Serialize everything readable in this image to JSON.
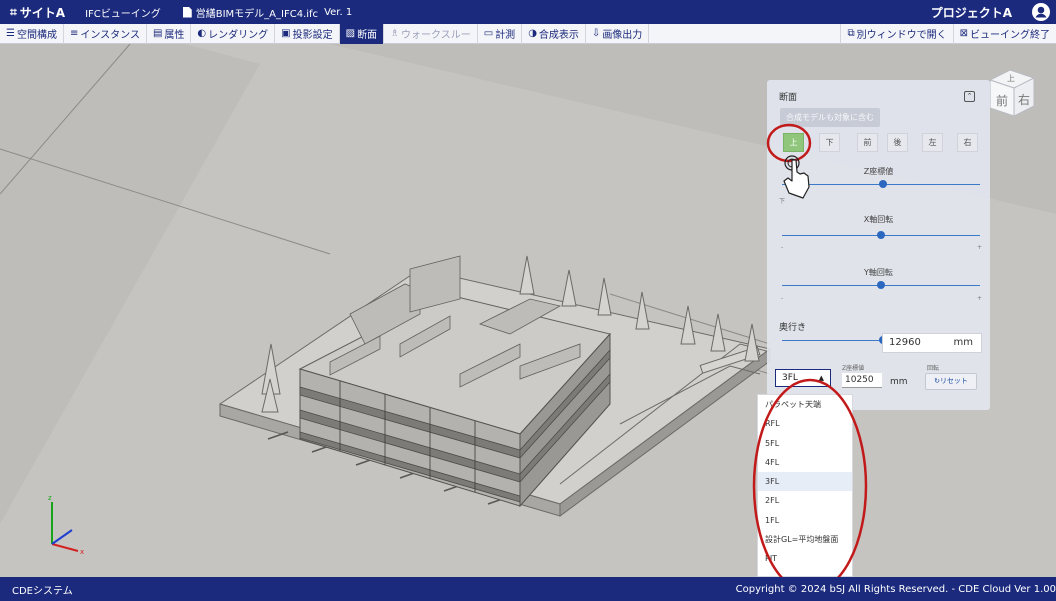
{
  "header": {
    "site_label": "サイトA",
    "app_label": "IFCビューイング",
    "file_name": "営繕BIMモデル_A_IFC4.ifc",
    "version": "Ver. 1",
    "project": "プロジェクトA"
  },
  "toolbar": {
    "items": [
      {
        "icon": "☰",
        "label": "空間構成"
      },
      {
        "icon": "≡",
        "label": "インスタンス"
      },
      {
        "icon": "▤",
        "label": "属性"
      },
      {
        "icon": "◐",
        "label": "レンダリング"
      },
      {
        "icon": "▣",
        "label": "投影設定"
      },
      {
        "icon": "▨",
        "label": "断面"
      },
      {
        "icon": "♗",
        "label": "ウォークスルー"
      },
      {
        "icon": "▭",
        "label": "計測"
      },
      {
        "icon": "◑",
        "label": "合成表示"
      },
      {
        "icon": "⇩",
        "label": "画像出力"
      }
    ],
    "active_index": 5,
    "disabled_index": 6,
    "open_window": "別ウィンドウで開く",
    "end_viewing": "ビューイング終了"
  },
  "section_panel": {
    "title": "断面",
    "include_models": "合成モデルも対象に含む",
    "directions": [
      "上",
      "下",
      "前",
      "後",
      "左",
      "右"
    ],
    "selected_direction": "上",
    "z_slider": {
      "label": "Z座標値",
      "min_label": "下",
      "value_fraction": 0.51
    },
    "x_slider": {
      "label": "X軸回転",
      "value_fraction": 0.5
    },
    "y_slider": {
      "label": "Y軸回転",
      "value_fraction": 0.5
    },
    "depth": {
      "label": "奥行き",
      "value": "12960",
      "unit": "mm",
      "value_fraction": 0.51
    },
    "floor_selected": "3FL",
    "z_caption": "Z座標値",
    "z_value": "10250",
    "z_unit": "mm",
    "rotation_caption": "回転",
    "reset_label": "リセット"
  },
  "floor_options": [
    "パラペット天端",
    "RFL",
    "5FL",
    "4FL",
    "3FL",
    "2FL",
    "1FL",
    "設計GL=平均地盤面",
    "PIT"
  ],
  "viewcube": {
    "top": "上",
    "front": "前",
    "right": "右"
  },
  "axes": {
    "x": "x",
    "y": "y",
    "z": "z"
  },
  "footer": {
    "system": "CDEシステム",
    "copyright": "Copyright © 2024 bSJ All Rights Reserved. - CDE Cloud Ver 1.00"
  },
  "colors": {
    "navy": "#1b2a7d",
    "selected_green": "#8fc67b",
    "highlight_red": "#c21a1a"
  }
}
